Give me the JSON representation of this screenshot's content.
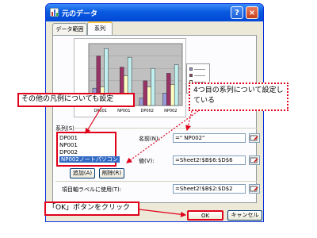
{
  "dialog": {
    "title": "元のデータ",
    "help_label": "?",
    "close_label": "×"
  },
  "tabs": [
    {
      "label": "データ範囲"
    },
    {
      "label": "系列"
    }
  ],
  "chart_preview": {
    "x_labels": [
      "DP001",
      "NP001",
      "DP002",
      "NP002"
    ],
    "legend_colors": [
      "#9b9bd8",
      "#993366",
      "#ffffc0",
      "#c0f0f0"
    ],
    "bars": [
      [
        0.28,
        0.8,
        0.3,
        0.92
      ],
      [
        0.18,
        0.62,
        0.48,
        0.78
      ],
      [
        0.12,
        0.4,
        0.3,
        0.6
      ],
      [
        0.2,
        0.52,
        0.34,
        0.66
      ]
    ]
  },
  "series_section": {
    "label": "系列(S)",
    "items": [
      "DP001",
      "NP001",
      "DP002",
      "NP002ノートパソコン"
    ],
    "selected_index": 3,
    "add_label": "追加(A)",
    "delete_label": "削除(R)"
  },
  "name_field": {
    "label": "名前(N):",
    "value": "=\" NP002\""
  },
  "value_field": {
    "label": "値(V):",
    "value": "=Sheet2!$B$6:$D$6"
  },
  "category_field": {
    "label": "項目軸ラベルに使用(T):",
    "value": "=Sheet2!$B$2:$D$2"
  },
  "buttons": {
    "ok_label": "OK",
    "cancel_label": "キャンセル"
  },
  "callouts": {
    "legend_note": "その他の凡例についても設定",
    "series_note": "4つ目の系列について設定している",
    "ok_note": "「OK」ボタンをクリック"
  }
}
